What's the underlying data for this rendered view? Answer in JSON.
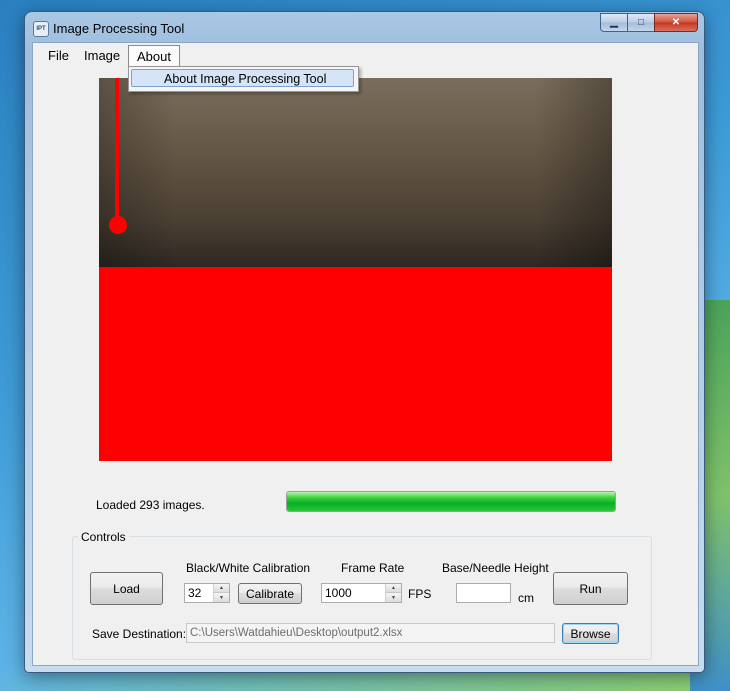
{
  "window": {
    "title": "Image Processing Tool",
    "icon_text": "IPT",
    "controls": {
      "minimize_icon": "minimize-icon",
      "maximize_icon": "maximize-icon",
      "close_icon": "close-icon"
    }
  },
  "menu": {
    "items": [
      "File",
      "Image",
      "About"
    ],
    "open_menu": "About",
    "dropdown_items": [
      "About Image Processing Tool"
    ]
  },
  "image_view": {
    "description_colors": {
      "fluid": "#ff0000",
      "background": "#5a4d3e"
    }
  },
  "status": {
    "text": "Loaded 293 images.",
    "progress": 1.0,
    "progress_color": "#06b025"
  },
  "controls": {
    "group_label": "Controls",
    "load_label": "Load",
    "calibration_label": "Black/White Calibration",
    "calibration_value": "32",
    "calibrate_label": "Calibrate",
    "frame_rate_label": "Frame Rate",
    "frame_rate_value": "1000",
    "fps_unit": "FPS",
    "needle_height_label": "Base/Needle Height",
    "needle_height_value": "",
    "cm_unit": "cm",
    "run_label": "Run",
    "save_destination_label": "Save Destination:",
    "save_destination_value": "C:\\Users\\Watdahieu\\Desktop\\output2.xlsx",
    "browse_label": "Browse"
  }
}
